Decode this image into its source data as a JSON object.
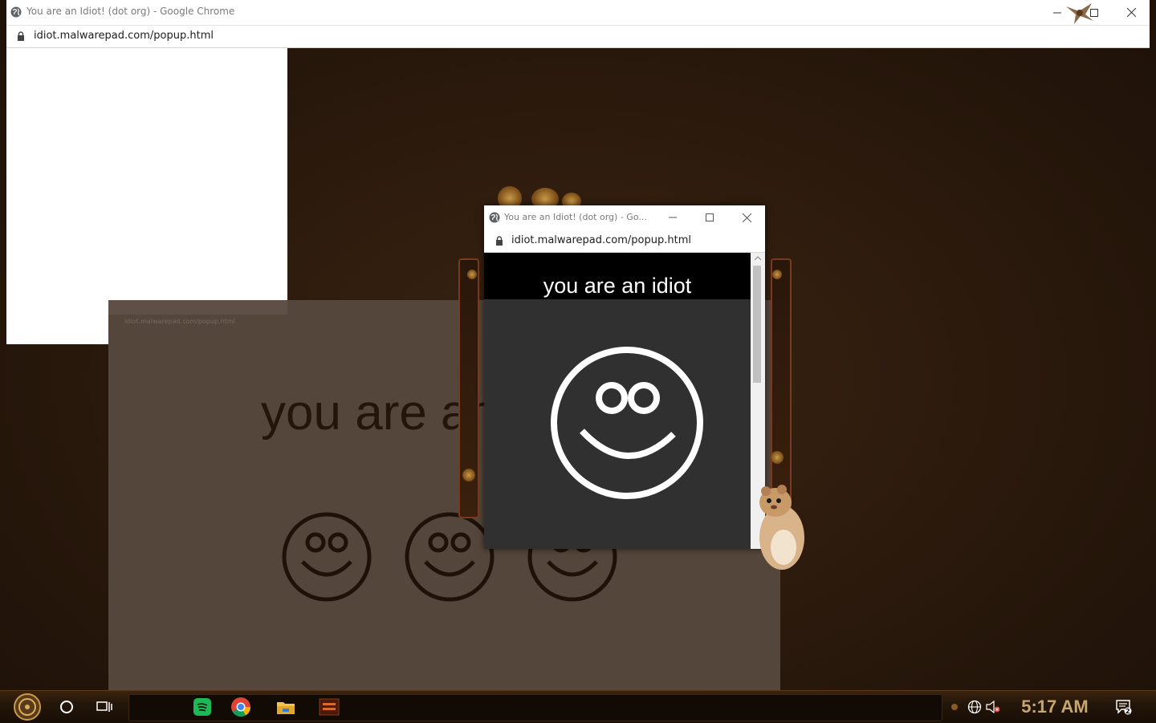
{
  "main_window": {
    "title": "You are an Idiot! (dot org) - Google Chrome",
    "url": "idiot.malwarepad.com/popup.html",
    "icon": "globe-icon"
  },
  "faded_popup": {
    "ghost_url": "idiot.malwarepad.com/popup.html",
    "text": "you are an idiot",
    "faces": [
      "smiley-icon",
      "smiley-icon",
      "smiley-icon"
    ]
  },
  "popup": {
    "title": "You are an Idiot! (dot org) - Go...",
    "url": "idiot.malwarepad.com/popup.html",
    "message": "you are an idiot",
    "face": "smiley-icon"
  },
  "taskbar": {
    "clock": "5:17 AM",
    "notification_count": "2",
    "apps": [
      "start-button",
      "cortana-search",
      "task-view",
      "spotify-icon",
      "chrome-icon",
      "file-explorer-icon",
      "app-thumbnail"
    ],
    "tray": [
      "globe-network-icon",
      "speaker-muted-icon"
    ]
  },
  "colors": {
    "desktop": "#2b1a0e",
    "popup_band": "#000000",
    "popup_body": "#303030",
    "clock": "#c9a66b"
  }
}
